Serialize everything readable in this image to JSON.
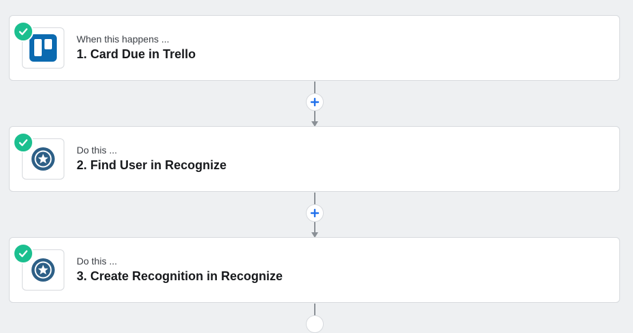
{
  "steps": [
    {
      "label": "When this happens ...",
      "title": "1. Card Due in Trello",
      "app_icon": "trello-icon",
      "status": "complete"
    },
    {
      "label": "Do this ...",
      "title": "2. Find User in Recognize",
      "app_icon": "recognize-icon",
      "status": "complete"
    },
    {
      "label": "Do this ...",
      "title": "3. Create Recognition in Recognize",
      "app_icon": "recognize-icon",
      "status": "complete"
    }
  ],
  "colors": {
    "check": "#1bbf8f",
    "plus": "#1f6feb",
    "trello": "#0b6ab0",
    "recognize": "#2d5f86",
    "connector": "#8a9096"
  },
  "icons": {
    "status": "check-icon",
    "add_step": "plus-icon"
  }
}
